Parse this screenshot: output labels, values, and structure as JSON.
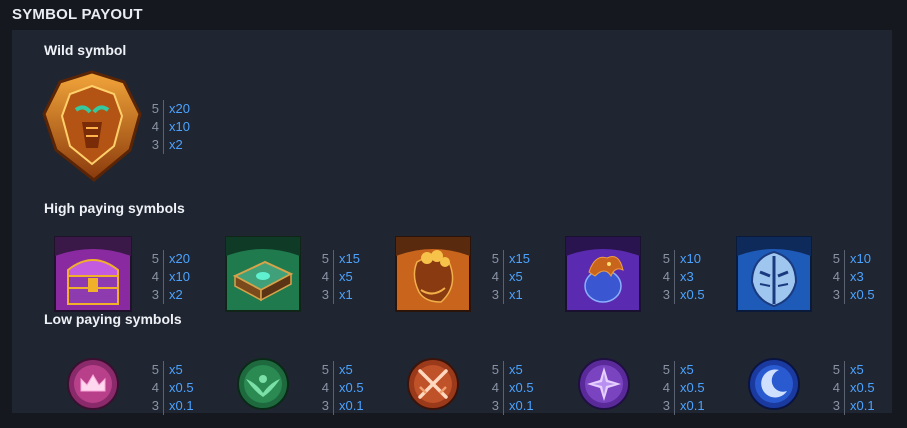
{
  "title": "SYMBOL PAYOUT",
  "sections": {
    "wild": "Wild symbol",
    "high": "High paying symbols",
    "low": "Low paying symbols"
  },
  "wild_symbol": {
    "icon": "wild-mask-icon",
    "payouts": [
      {
        "count": "5",
        "mult": "x20"
      },
      {
        "count": "4",
        "mult": "x10"
      },
      {
        "count": "3",
        "mult": "x2"
      }
    ]
  },
  "high_symbols": [
    {
      "icon": "treasure-chest-icon",
      "payouts": [
        {
          "count": "5",
          "mult": "x20"
        },
        {
          "count": "4",
          "mult": "x10"
        },
        {
          "count": "3",
          "mult": "x2"
        }
      ]
    },
    {
      "icon": "spellbook-icon",
      "payouts": [
        {
          "count": "5",
          "mult": "x15"
        },
        {
          "count": "4",
          "mult": "x5"
        },
        {
          "count": "3",
          "mult": "x1"
        }
      ]
    },
    {
      "icon": "coin-pouch-icon",
      "payouts": [
        {
          "count": "5",
          "mult": "x15"
        },
        {
          "count": "4",
          "mult": "x5"
        },
        {
          "count": "3",
          "mult": "x1"
        }
      ]
    },
    {
      "icon": "dragon-egg-icon",
      "payouts": [
        {
          "count": "5",
          "mult": "x10"
        },
        {
          "count": "4",
          "mult": "x3"
        },
        {
          "count": "3",
          "mult": "x0.5"
        }
      ]
    },
    {
      "icon": "knight-helmet-icon",
      "payouts": [
        {
          "count": "5",
          "mult": "x10"
        },
        {
          "count": "4",
          "mult": "x3"
        },
        {
          "count": "3",
          "mult": "x0.5"
        }
      ]
    }
  ],
  "low_symbols": [
    {
      "icon": "crown-rune-icon",
      "payouts": [
        {
          "count": "5",
          "mult": "x5"
        },
        {
          "count": "4",
          "mult": "x0.5"
        },
        {
          "count": "3",
          "mult": "x0.1"
        }
      ]
    },
    {
      "icon": "eagle-rune-icon",
      "payouts": [
        {
          "count": "5",
          "mult": "x5"
        },
        {
          "count": "4",
          "mult": "x0.5"
        },
        {
          "count": "3",
          "mult": "x0.1"
        }
      ]
    },
    {
      "icon": "crossed-swords-rune-icon",
      "payouts": [
        {
          "count": "5",
          "mult": "x5"
        },
        {
          "count": "4",
          "mult": "x0.5"
        },
        {
          "count": "3",
          "mult": "x0.1"
        }
      ]
    },
    {
      "icon": "star-rune-icon",
      "payouts": [
        {
          "count": "5",
          "mult": "x5"
        },
        {
          "count": "4",
          "mult": "x0.5"
        },
        {
          "count": "3",
          "mult": "x0.1"
        }
      ]
    },
    {
      "icon": "moon-rune-icon",
      "payouts": [
        {
          "count": "5",
          "mult": "x5"
        },
        {
          "count": "4",
          "mult": "x0.5"
        },
        {
          "count": "3",
          "mult": "x0.1"
        }
      ]
    }
  ],
  "colors": {
    "background": "#15181f",
    "panel": "#1f2531",
    "multiplier": "#4ca3ff",
    "count": "#8a93a4"
  }
}
